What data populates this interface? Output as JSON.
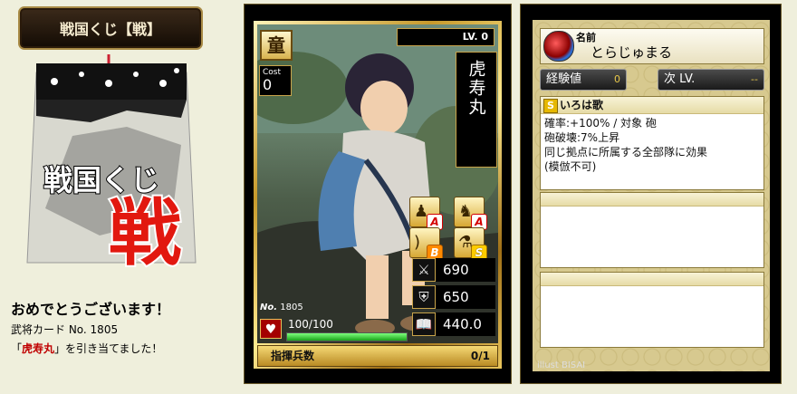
{
  "title": "戦国くじ【戦】",
  "kuji": {
    "line1": "戦国くじ",
    "big": "戦"
  },
  "congrats": "おめでとうございます！",
  "card_line": "武将カード No. 1805",
  "draw_line": {
    "pre": "「",
    "name": "虎寿丸",
    "post": "」を引き当てました！"
  },
  "card": {
    "level": "LV. 0",
    "rarity": "童",
    "cost_label": "Cost",
    "cost": "0",
    "name": "虎寿丸",
    "skills": [
      {
        "icon": "spear-soldier-icon",
        "rank": "A"
      },
      {
        "icon": "cavalry-icon",
        "rank": "A"
      },
      {
        "icon": "bow-icon",
        "rank": "B"
      },
      {
        "icon": "gun-icon",
        "rank": "S"
      }
    ],
    "attack": "690",
    "defense": "650",
    "strategy": "440.0",
    "no_label": "No.",
    "no": "1805",
    "hp": "100/100",
    "hp_fraction": 1.0,
    "command_label": "指揮兵数",
    "command_value": "0/1"
  },
  "info": {
    "name_label": "名前",
    "name_value": "とらじゅまる",
    "exp_label": "経験値",
    "exp_value": "0",
    "next_label": "次 LV.",
    "next_value": "--",
    "skill": {
      "rank": "S",
      "name": "いろは歌",
      "lines": [
        "確率:+100% / 対象 砲",
        "砲破壊:7%上昇",
        "同じ拠点に所属する全部隊に効果",
        "(模倣不可)"
      ]
    },
    "illust": "illust BISAI"
  },
  "colors": {
    "background": "#efefdc",
    "gold": "#c9a44a",
    "accent_red": "#c00000"
  }
}
